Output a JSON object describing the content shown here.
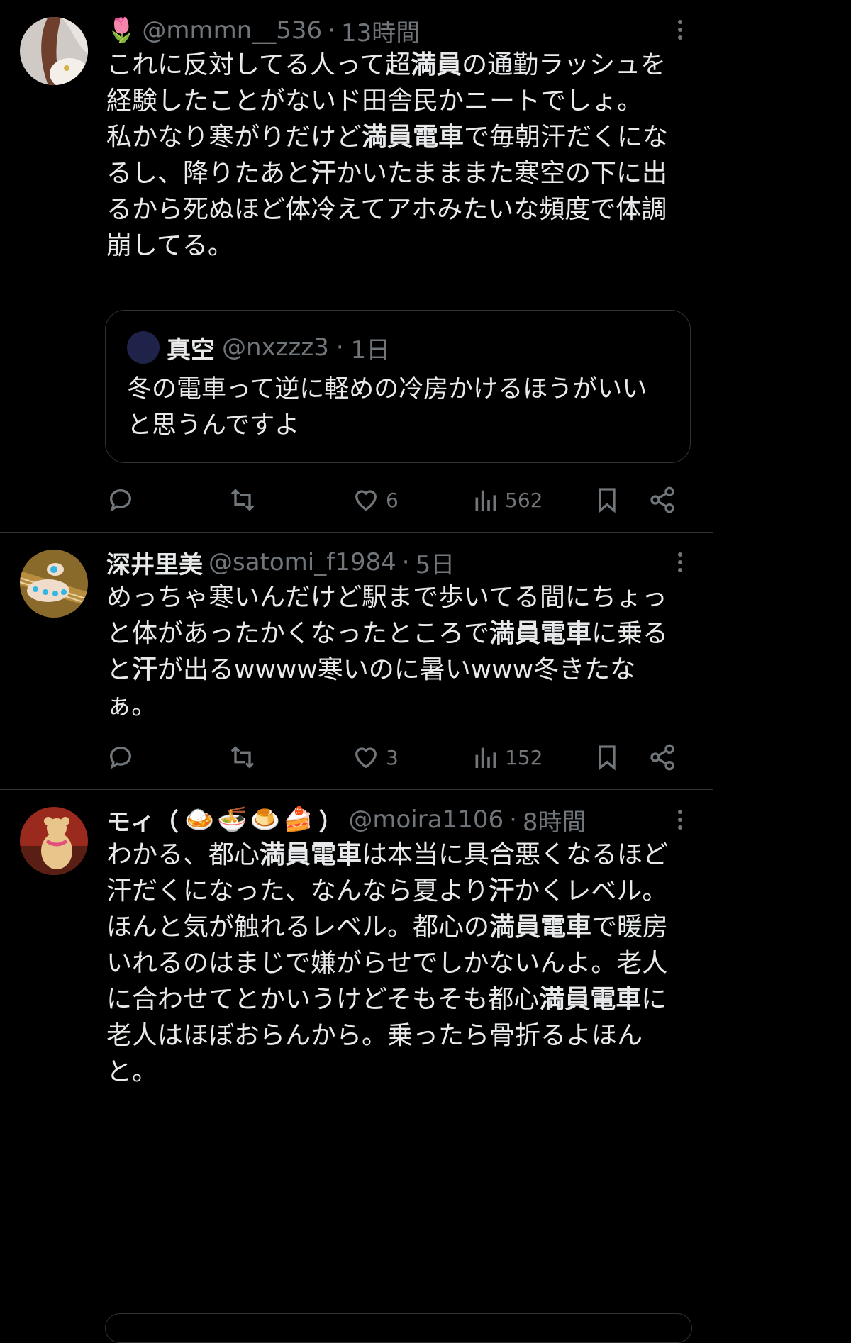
{
  "posts": [
    {
      "display_emoji": "🌷",
      "handle": "@mmmn__536",
      "sep": "·",
      "time": "13時間",
      "text": [
        [
          "これに反対してる人って超",
          ""
        ],
        [
          "満員",
          "b"
        ],
        [
          "の通勤ラッシュを経験したことがないド田舎民かニートでしょ。\n私かなり寒がりだけど",
          ""
        ],
        [
          "満員電車",
          "b"
        ],
        [
          "で毎朝汗だくになるし、降りたあと",
          ""
        ],
        [
          "汗",
          "b"
        ],
        [
          "かいたまままた寒空の下に出るから死ぬほど体冷えてアホみたいな頻度で体調崩してる。",
          ""
        ]
      ],
      "quote": {
        "name": "真空",
        "handle": "@nxzzz3",
        "sep": "·",
        "time": "1日",
        "text": "冬の電車って逆に軽めの冷房かけるほうがいいと思うんですよ"
      },
      "likes": "6",
      "views": "562"
    },
    {
      "name": "深井里美",
      "handle": "@satomi_f1984",
      "sep": "·",
      "time": "5日",
      "text": [
        [
          "めっちゃ寒いんだけど駅まで歩いてる間にちょっと体があったかくなったところで",
          ""
        ],
        [
          "満員電車",
          "b"
        ],
        [
          "に乗ると",
          ""
        ],
        [
          "汗",
          "b"
        ],
        [
          "が出るwwww寒いのに暑いwww冬きたなぁ。",
          ""
        ]
      ],
      "likes": "3",
      "views": "152"
    },
    {
      "name": "モィ（",
      "name_end": "）",
      "name_emoji": [
        "🍛",
        "🍜",
        "🍮",
        "🍰"
      ],
      "handle": "@moira1106",
      "sep": "·",
      "time": "8時間",
      "text": [
        [
          "わかる、都心",
          ""
        ],
        [
          "満員電車",
          "b"
        ],
        [
          "は本当に具合悪くなるほど汗だくになった、なんなら夏より",
          ""
        ],
        [
          "汗",
          "b"
        ],
        [
          "かくレベル。ほんと気が触れるレベル。都心の",
          ""
        ],
        [
          "満員電車",
          "b"
        ],
        [
          "で暖房いれるのはまじで嫌がらせでしかないんよ。老人に合わせてとかいうけどそもそも都心",
          ""
        ],
        [
          "満員電車",
          "b"
        ],
        [
          "に老人はほぼおらんから。乗ったら骨折るよほんと。",
          ""
        ]
      ]
    }
  ],
  "icons": {
    "reply": "reply-icon",
    "retweet": "retweet-icon",
    "like": "heart-icon",
    "views": "views-icon",
    "bookmark": "bookmark-icon",
    "share": "share-icon",
    "more": "more-icon"
  },
  "colors": {
    "background": "#000000",
    "text": "#e7e9ea",
    "muted": "#71767b",
    "divider": "#2f3336"
  }
}
